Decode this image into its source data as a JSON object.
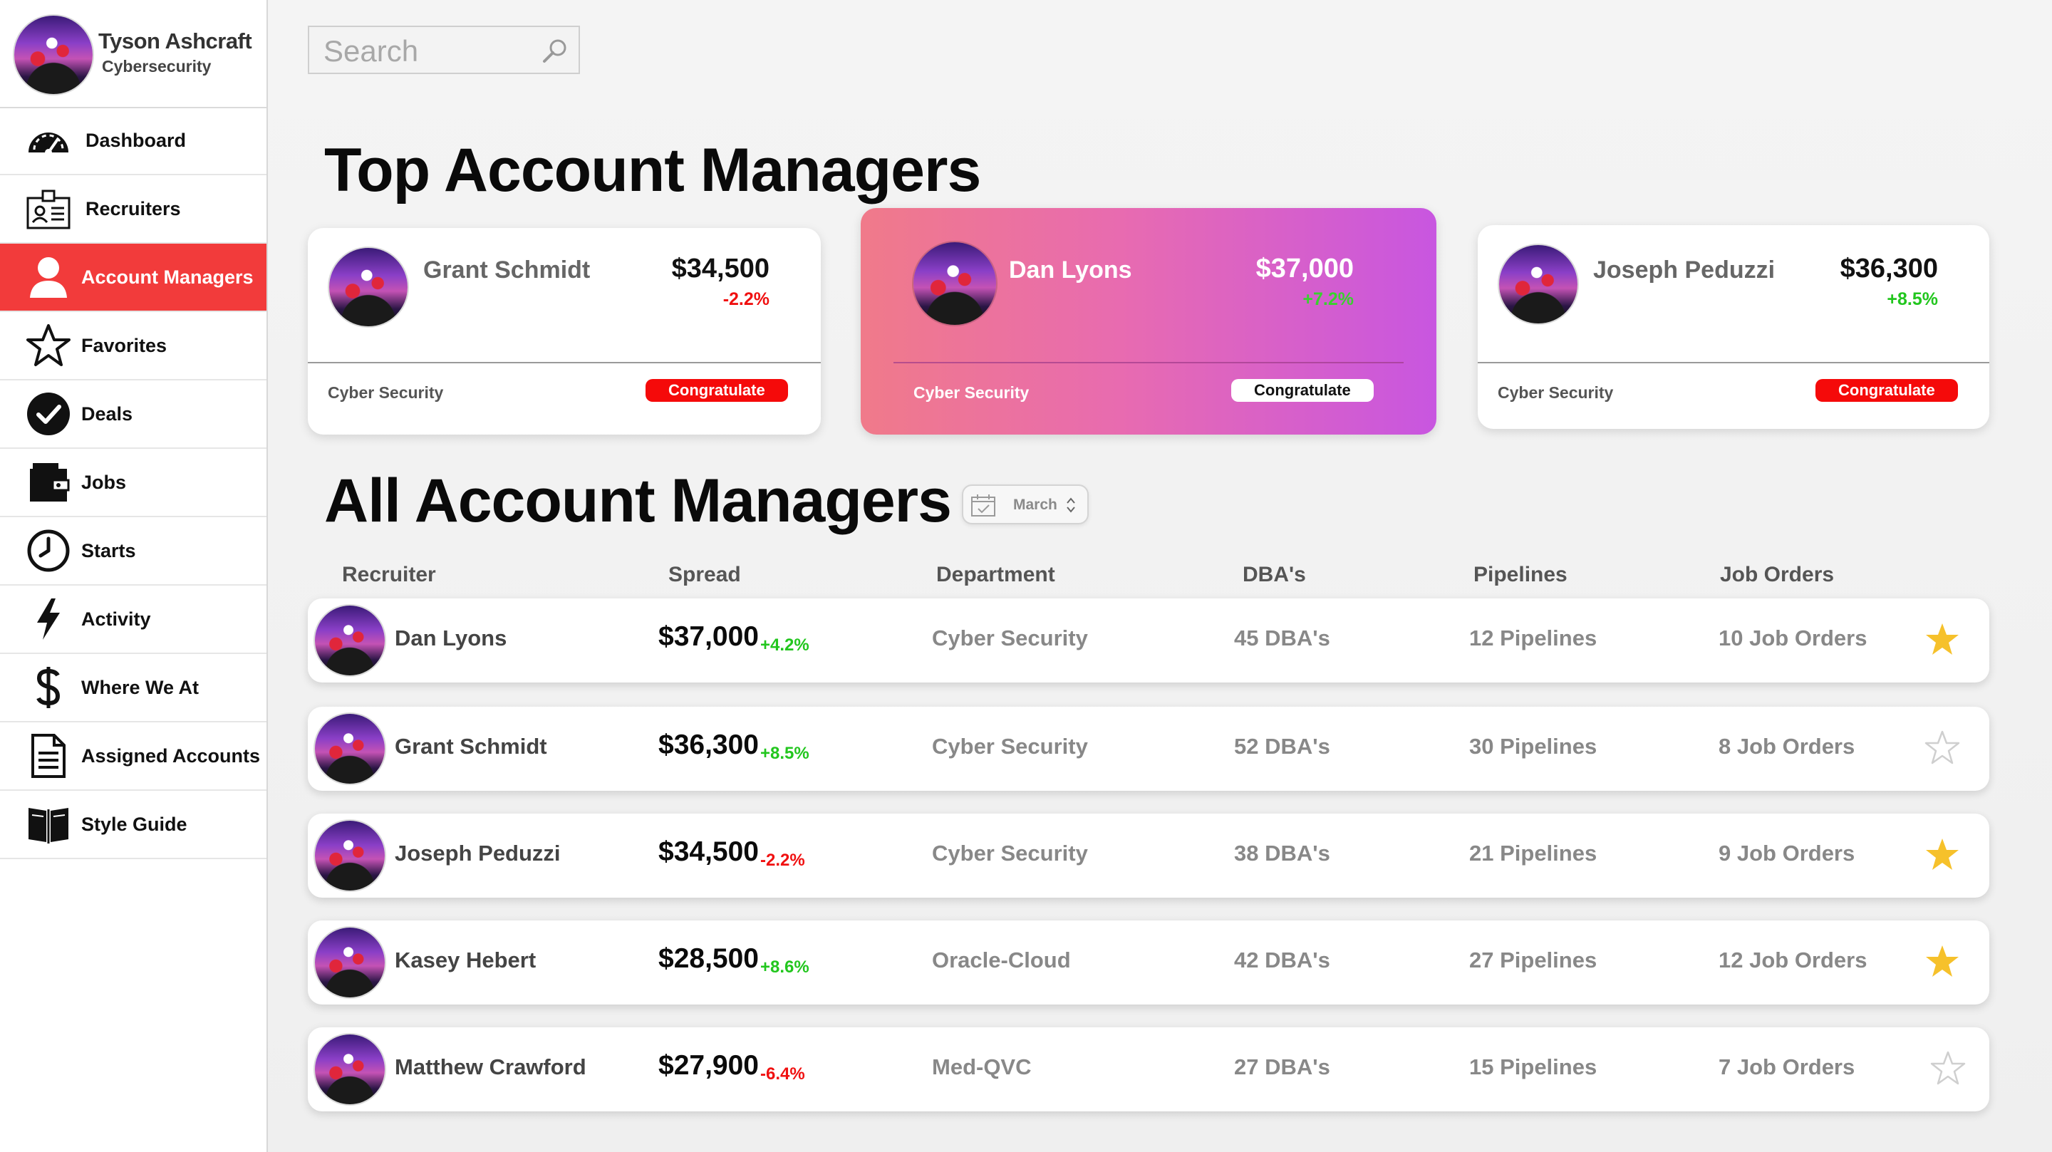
{
  "profile": {
    "name": "Tyson Ashcraft",
    "role": "Cybersecurity"
  },
  "sidebar": {
    "items": [
      {
        "label": "Dashboard",
        "icon": "speedometer-icon",
        "active": false
      },
      {
        "label": "Recruiters",
        "icon": "id-card-icon",
        "active": false
      },
      {
        "label": "Account Managers",
        "icon": "user-icon",
        "active": true
      },
      {
        "label": "Favorites",
        "icon": "star-outline-icon",
        "active": false
      },
      {
        "label": "Deals",
        "icon": "check-circle-icon",
        "active": false
      },
      {
        "label": "Jobs",
        "icon": "wallet-icon",
        "active": false
      },
      {
        "label": "Starts",
        "icon": "clock-icon",
        "active": false
      },
      {
        "label": "Activity",
        "icon": "lightning-icon",
        "active": false
      },
      {
        "label": "Where We At",
        "icon": "dollar-icon",
        "active": false
      },
      {
        "label": "Assigned Accounts",
        "icon": "document-icon",
        "active": false
      },
      {
        "label": "Style Guide",
        "icon": "book-icon",
        "active": false
      }
    ]
  },
  "search": {
    "placeholder": "Search"
  },
  "top_section": {
    "title": "Top Account Managers",
    "cards": [
      {
        "name": "Grant Schmidt",
        "amount": "$34,500",
        "change": "-2.2%",
        "trend": "down",
        "department": "Cyber Security",
        "button": "Congratulate",
        "featured": false
      },
      {
        "name": "Dan Lyons",
        "amount": "$37,000",
        "change": "+7.2%",
        "trend": "up",
        "department": "Cyber Security",
        "button": "Congratulate",
        "featured": true
      },
      {
        "name": "Joseph Peduzzi",
        "amount": "$36,300",
        "change": "+8.5%",
        "trend": "up",
        "department": "Cyber Security",
        "button": "Congratulate",
        "featured": false
      }
    ]
  },
  "all_section": {
    "title": "All Account Managers",
    "month": "March",
    "columns": [
      "Recruiter",
      "Spread",
      "Department",
      "DBA's",
      "Pipelines",
      "Job Orders"
    ],
    "rows": [
      {
        "name": "Dan Lyons",
        "spread": "$37,000",
        "change": "+4.2%",
        "trend": "up",
        "department": "Cyber Security",
        "dbas": "45 DBA's",
        "pipelines": "12 Pipelines",
        "job_orders": "10 Job Orders",
        "favorite": true
      },
      {
        "name": "Grant Schmidt",
        "spread": "$36,300",
        "change": "+8.5%",
        "trend": "up",
        "department": "Cyber Security",
        "dbas": "52 DBA's",
        "pipelines": "30 Pipelines",
        "job_orders": "8 Job Orders",
        "favorite": false
      },
      {
        "name": "Joseph Peduzzi",
        "spread": "$34,500",
        "change": "-2.2%",
        "trend": "down",
        "department": "Cyber Security",
        "dbas": "38 DBA's",
        "pipelines": "21 Pipelines",
        "job_orders": "9 Job Orders",
        "favorite": true
      },
      {
        "name": "Kasey Hebert",
        "spread": "$28,500",
        "change": "+8.6%",
        "trend": "up",
        "department": "Oracle-Cloud",
        "dbas": "42 DBA's",
        "pipelines": "27 Pipelines",
        "job_orders": "12 Job Orders",
        "favorite": true
      },
      {
        "name": "Matthew Crawford",
        "spread": "$27,900",
        "change": "-6.4%",
        "trend": "down",
        "department": "Med-QVC",
        "dbas": "27 DBA's",
        "pipelines": "15 Pipelines",
        "job_orders": "7 Job Orders",
        "favorite": false
      }
    ]
  },
  "colors": {
    "accent": "#f23b3b",
    "up": "#22c61e",
    "down": "#f01010",
    "star": "#f6c12b",
    "featured_gradient_start": "#f07a8a",
    "featured_gradient_end": "#c856e0"
  }
}
